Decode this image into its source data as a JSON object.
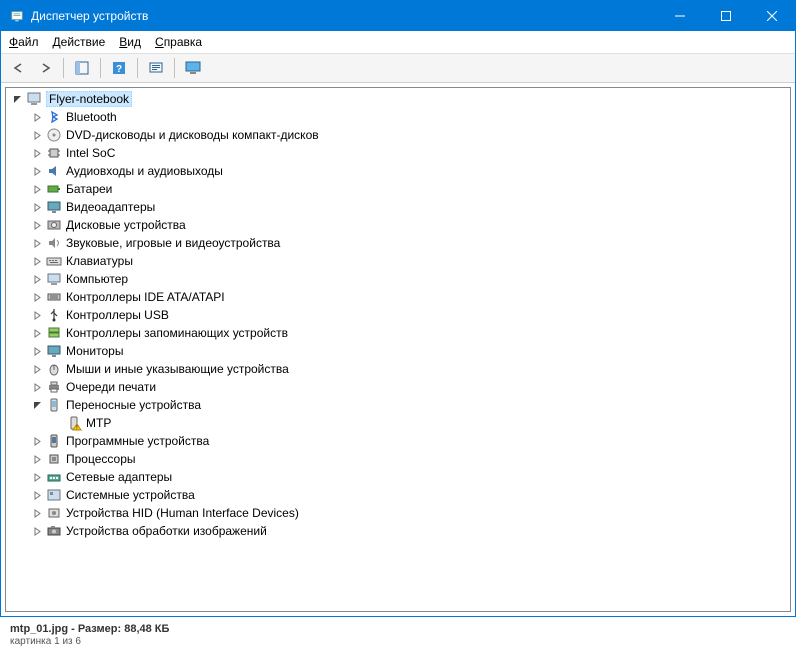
{
  "window": {
    "title": "Диспетчер устройств"
  },
  "menubar": {
    "file": "Файл",
    "action": "Действие",
    "view": "Вид",
    "help": "Справка"
  },
  "tree": {
    "root": {
      "label": "Flyer-notebook",
      "expanded": true,
      "selected": true
    },
    "items": [
      {
        "label": "Bluetooth",
        "icon": "bluetooth"
      },
      {
        "label": "DVD-дисководы и дисководы компакт-дисков",
        "icon": "dvd"
      },
      {
        "label": "Intel SoC",
        "icon": "chip"
      },
      {
        "label": "Аудиовходы и аудиовыходы",
        "icon": "audio"
      },
      {
        "label": "Батареи",
        "icon": "battery"
      },
      {
        "label": "Видеоадаптеры",
        "icon": "display"
      },
      {
        "label": "Дисковые устройства",
        "icon": "disk"
      },
      {
        "label": "Звуковые, игровые и видеоустройства",
        "icon": "sound"
      },
      {
        "label": "Клавиатуры",
        "icon": "keyboard"
      },
      {
        "label": "Компьютер",
        "icon": "computer"
      },
      {
        "label": "Контроллеры IDE ATA/ATAPI",
        "icon": "ide"
      },
      {
        "label": "Контроллеры USB",
        "icon": "usb"
      },
      {
        "label": "Контроллеры запоминающих устройств",
        "icon": "storage"
      },
      {
        "label": "Мониторы",
        "icon": "monitor"
      },
      {
        "label": "Мыши и иные указывающие устройства",
        "icon": "mouse"
      },
      {
        "label": "Очереди печати",
        "icon": "printer"
      },
      {
        "label": "Переносные устройства",
        "icon": "portable",
        "expanded": true,
        "children": [
          {
            "label": "MTP",
            "icon": "warning"
          }
        ]
      },
      {
        "label": "Программные устройства",
        "icon": "software"
      },
      {
        "label": "Процессоры",
        "icon": "cpu"
      },
      {
        "label": "Сетевые адаптеры",
        "icon": "network"
      },
      {
        "label": "Системные устройства",
        "icon": "system"
      },
      {
        "label": "Устройства HID (Human Interface Devices)",
        "icon": "hid"
      },
      {
        "label": "Устройства обработки изображений",
        "icon": "imaging"
      }
    ]
  },
  "footer": {
    "filename": "mtp_01.jpg",
    "size_label": "Размер:",
    "size_value": "88,48 КБ",
    "counter": "картинка 1 из 6"
  }
}
